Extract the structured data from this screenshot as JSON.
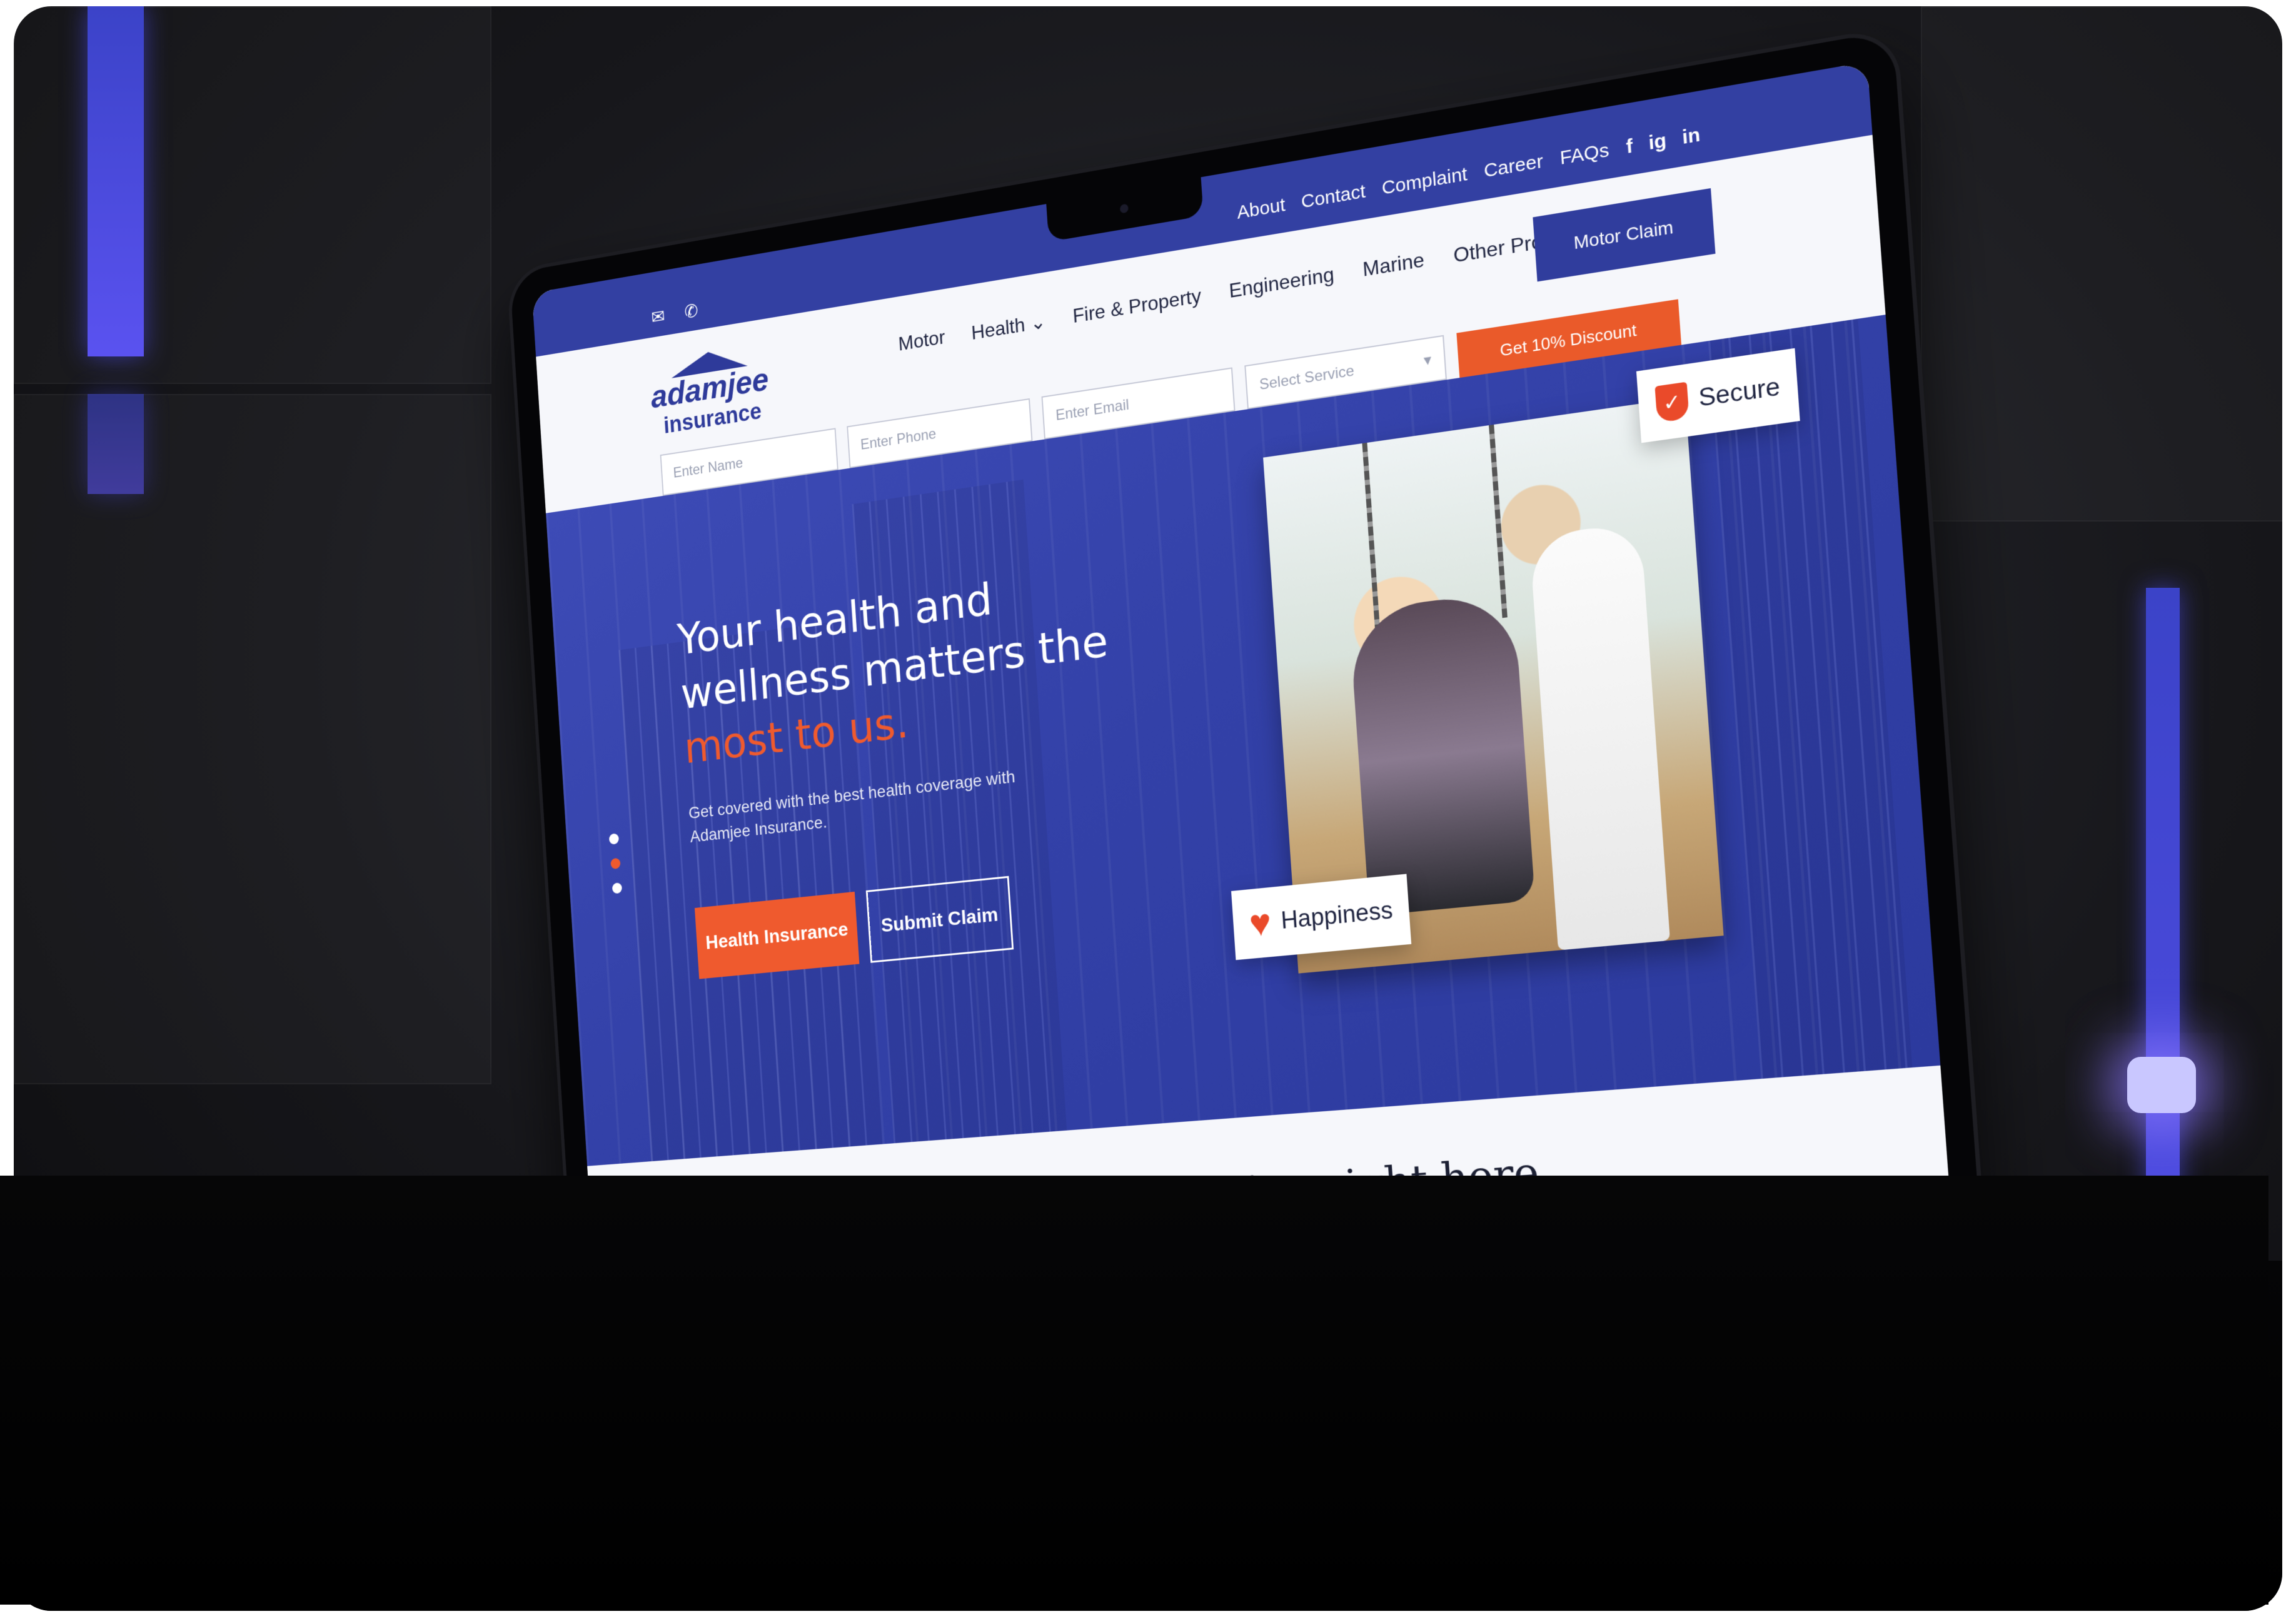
{
  "topbar": {
    "contact_icons": [
      "email-icon",
      "phone-icon"
    ],
    "links": [
      "About",
      "Contact",
      "Complaint",
      "Career",
      "FAQs"
    ],
    "social": [
      "f",
      "ig",
      "in"
    ]
  },
  "logo": {
    "line1": "adamjee",
    "line2": "insurance"
  },
  "nav": {
    "items": [
      "Motor",
      "Health ⌄",
      "Fire & Property",
      "Engineering",
      "Marine",
      "Other Products ⌄"
    ],
    "motor_claim": "Motor Claim"
  },
  "form": {
    "name_placeholder": "Enter Name",
    "phone_placeholder": "Enter Phone",
    "email_placeholder": "Enter Email",
    "service_placeholder": "Select Service",
    "discount_button": "Get 10% Discount"
  },
  "hero": {
    "headline_line1": "Your health and",
    "headline_line2": "wellness matters the",
    "headline_accent": "most to us.",
    "subtext": "Get covered with the best health coverage with Adamjee Insurance.",
    "primary_button": "Health Insurance",
    "secondary_button": "Submit Claim",
    "badge_secure": "Secure",
    "badge_happiness": "Happiness",
    "slider_active_index": 1
  },
  "section2": {
    "heading": "…ything right here"
  },
  "colors": {
    "brand_blue": "#3340a2",
    "accent_orange": "#ef5a2e",
    "underline_green": "#1aa58a"
  }
}
